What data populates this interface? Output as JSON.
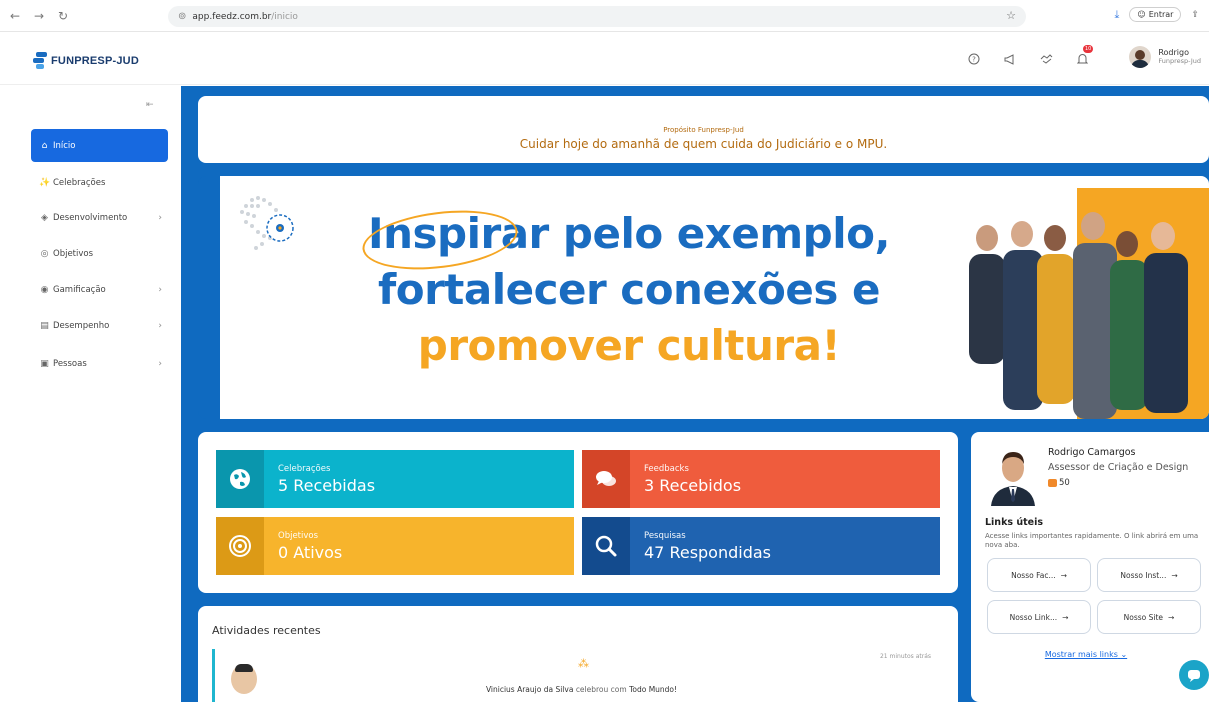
{
  "browser": {
    "url_host": "app.feedz.com.br",
    "url_path": "/inicio",
    "signin_label": "Entrar"
  },
  "header": {
    "logo_text": "FUNPRESP-JUD",
    "notification_count": "10",
    "user_name": "Rodrigo",
    "user_org": "Funpresp-Jud"
  },
  "sidebar": {
    "items": [
      {
        "label": "Início",
        "icon": "home-icon"
      },
      {
        "label": "Celebrações",
        "icon": "party-icon"
      },
      {
        "label": "Desenvolvimento",
        "icon": "development-icon"
      },
      {
        "label": "Objetivos",
        "icon": "target-icon"
      },
      {
        "label": "Gamificação",
        "icon": "gamification-icon"
      },
      {
        "label": "Desempenho",
        "icon": "performance-icon"
      },
      {
        "label": "Pessoas",
        "icon": "people-icon"
      }
    ]
  },
  "purpose": {
    "title": "Propósito Funpresp-Jud",
    "text": "Cuidar hoje do amanhã de quem cuida do Judiciário e o MPU."
  },
  "hero": {
    "line1_highlight": "Inspirar",
    "line1_rest": " pelo exemplo,",
    "line2": "fortalecer conexões e",
    "line3": "promover cultura!"
  },
  "stats": [
    {
      "label": "Celebrações",
      "value": "5 Recebidas",
      "color": "#0bb3cc",
      "dark": "#0a96ad",
      "icon": "globe-icon"
    },
    {
      "label": "Feedbacks",
      "value": "3 Recebidos",
      "color": "#ef5c3d",
      "dark": "#d44528",
      "icon": "chat-bubbles-icon"
    },
    {
      "label": "Objetivos",
      "value": "0 Ativos",
      "color": "#f7b42c",
      "dark": "#dc9a16",
      "icon": "target-icon"
    },
    {
      "label": "Pesquisas",
      "value": "47 Respondidas",
      "color": "#1f63b0",
      "dark": "#134b8e",
      "icon": "search-icon"
    }
  ],
  "recent": {
    "title": "Atividades recentes",
    "time": "21 minutos atrás",
    "actor": "Vinicius Araujo da Silva",
    "verb": "celebrou com",
    "target": "Todo Mundo!"
  },
  "profile": {
    "name": "Rodrigo Camargos",
    "role": "Assessor de Criação e Design",
    "coins": "50",
    "links_title": "Links úteis",
    "links_desc": "Acesse links importantes rapidamente. O link abrirá em uma nova aba.",
    "links": [
      "Nosso Fac...",
      "Nosso Inst...",
      "Nosso Link...",
      "Nosso Site"
    ],
    "more_links": "Mostrar mais links"
  }
}
